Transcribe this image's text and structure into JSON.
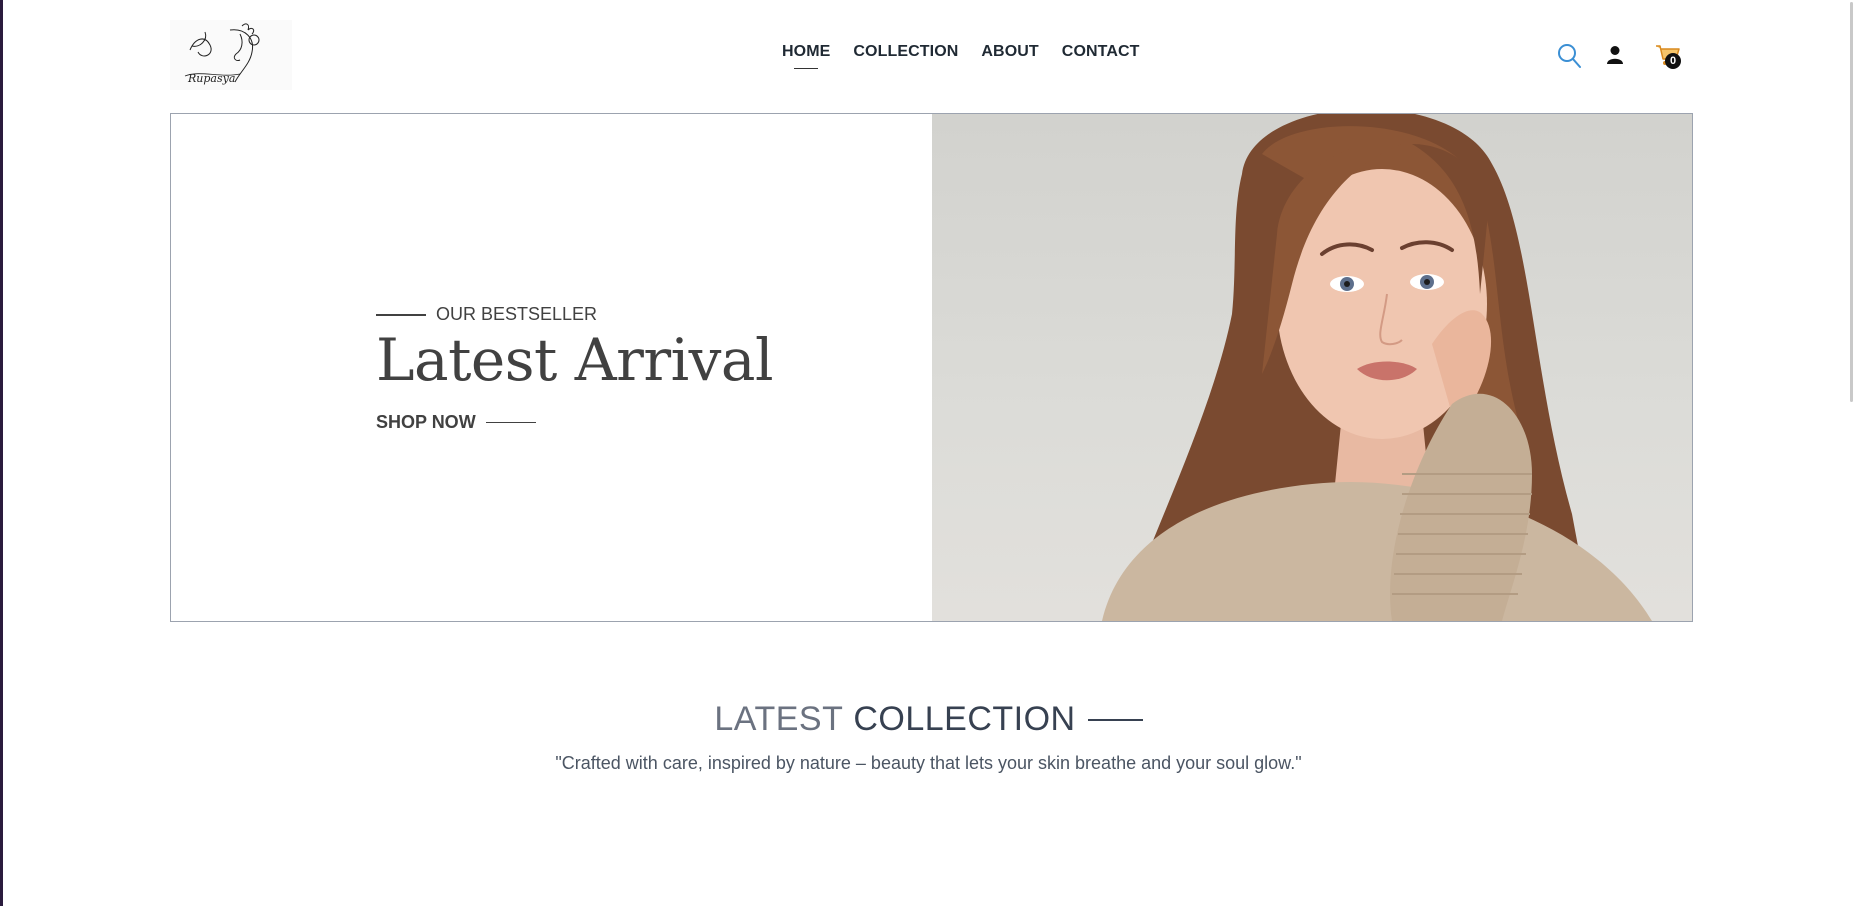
{
  "logo": {
    "text": "Rupasya"
  },
  "nav": {
    "items": [
      {
        "label": "HOME"
      },
      {
        "label": "COLLECTION"
      },
      {
        "label": "ABOUT"
      },
      {
        "label": "CONTACT"
      }
    ]
  },
  "header_icons": {
    "search": "search-icon",
    "user": "user-icon",
    "cart": "cart-icon",
    "cart_count": "0"
  },
  "hero": {
    "eyebrow": "OUR BESTSELLER",
    "title": "Latest Arrival",
    "cta": "SHOP NOW"
  },
  "latest_collection": {
    "title_light": "LATEST",
    "title_dark": "COLLECTION",
    "subtitle": "\"Crafted with care, inspired by nature – beauty that lets your skin breathe and your soul glow.\""
  },
  "colors": {
    "text_dark": "#414141",
    "search_icon": "#3b8fd4",
    "cart_icon": "#e8a23a"
  }
}
